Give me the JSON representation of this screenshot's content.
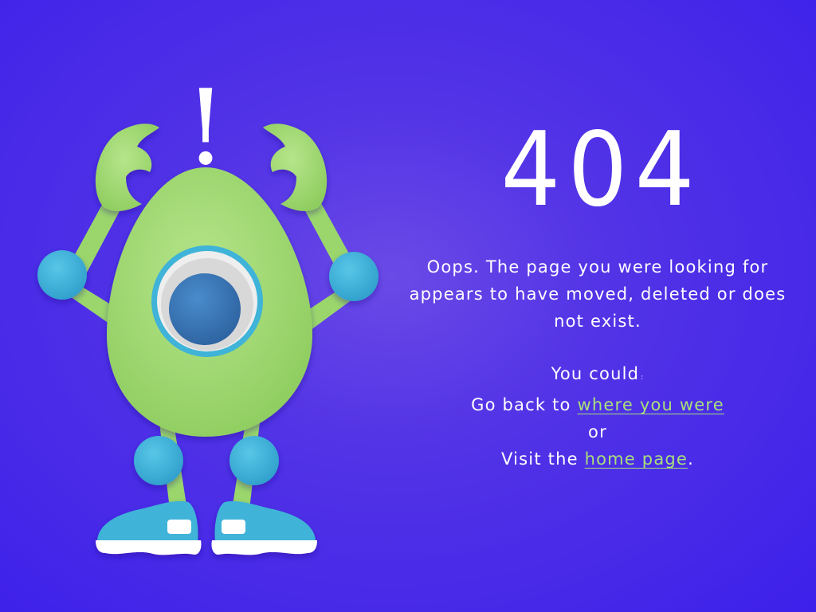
{
  "error": {
    "code": "404",
    "message": "Oops. The page you were looking for appears to have moved, deleted or does not exist."
  },
  "options": {
    "intro": "You could",
    "colon": ":",
    "back_prefix": "Go back to ",
    "back_link": "where you were",
    "or": "or",
    "home_prefix": "Visit the ",
    "home_link": "home page",
    "home_suffix": "."
  },
  "illustration": {
    "exclamation": "!"
  },
  "colors": {
    "background": "#5334e6",
    "text": "#ffffff",
    "link": "#a8e07a",
    "monster_body": "#9bd66c",
    "monster_joint": "#3fb3d8",
    "monster_eye_iris": "#3a77b8"
  }
}
